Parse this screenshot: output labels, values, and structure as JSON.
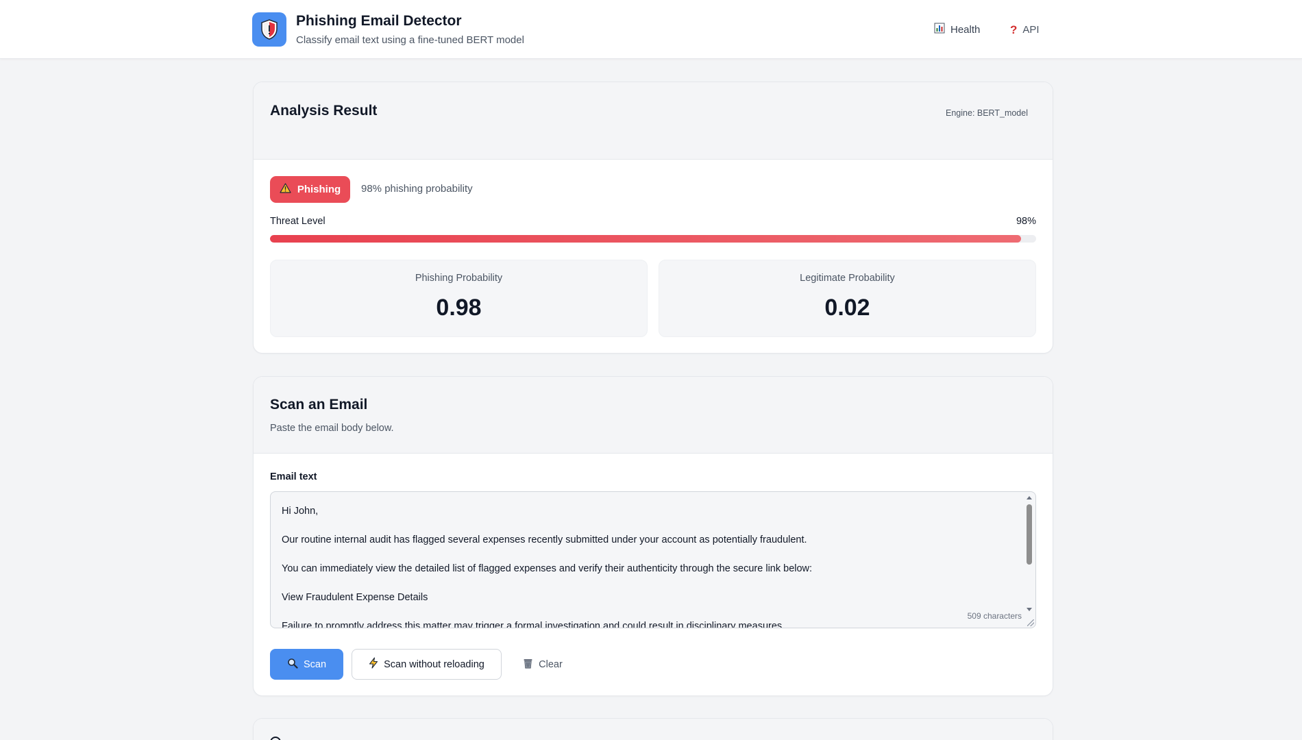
{
  "header": {
    "title": "Phishing Email Detector",
    "subtitle": "Classify email text using a fine-tuned BERT model",
    "logo_icon": "shield-icon",
    "nav": [
      {
        "label": "Health",
        "icon": "bar-chart-icon"
      },
      {
        "label": "API",
        "icon": "question-mark-icon"
      }
    ]
  },
  "result": {
    "title": "Analysis Result",
    "engine": "Engine: BERT_model",
    "verdict_label": "Phishing",
    "verdict_icon": "warning-icon",
    "verdict_probability_text": "98% phishing probability",
    "threat_label": "Threat Level",
    "threat_value": "98%",
    "threat_fraction": 0.98,
    "phishing_label": "Phishing Probability",
    "phishing_value": "0.98",
    "legit_label": "Legitimate Probability",
    "legit_value": "0.02"
  },
  "scan": {
    "title": "Scan an Email",
    "subtitle": "Paste the email body below.",
    "field_label": "Email text",
    "email_lines": [
      "Hi John,",
      "Our routine internal audit has flagged several expenses recently submitted under your account as potentially fraudulent.",
      "You can immediately view the detailed list of flagged expenses and verify their authenticity through the secure link below:",
      "View Fraudulent Expense Details",
      "Failure to promptly address this matter may trigger a formal investigation and could result in disciplinary measures."
    ],
    "char_count": "509 characters",
    "buttons": {
      "scan": "Scan",
      "scan_no_reload": "Scan without reloading",
      "clear": "Clear"
    }
  },
  "colors": {
    "accent": "#4a8ef0",
    "danger": "#ea4c57",
    "background": "#f3f4f6"
  }
}
